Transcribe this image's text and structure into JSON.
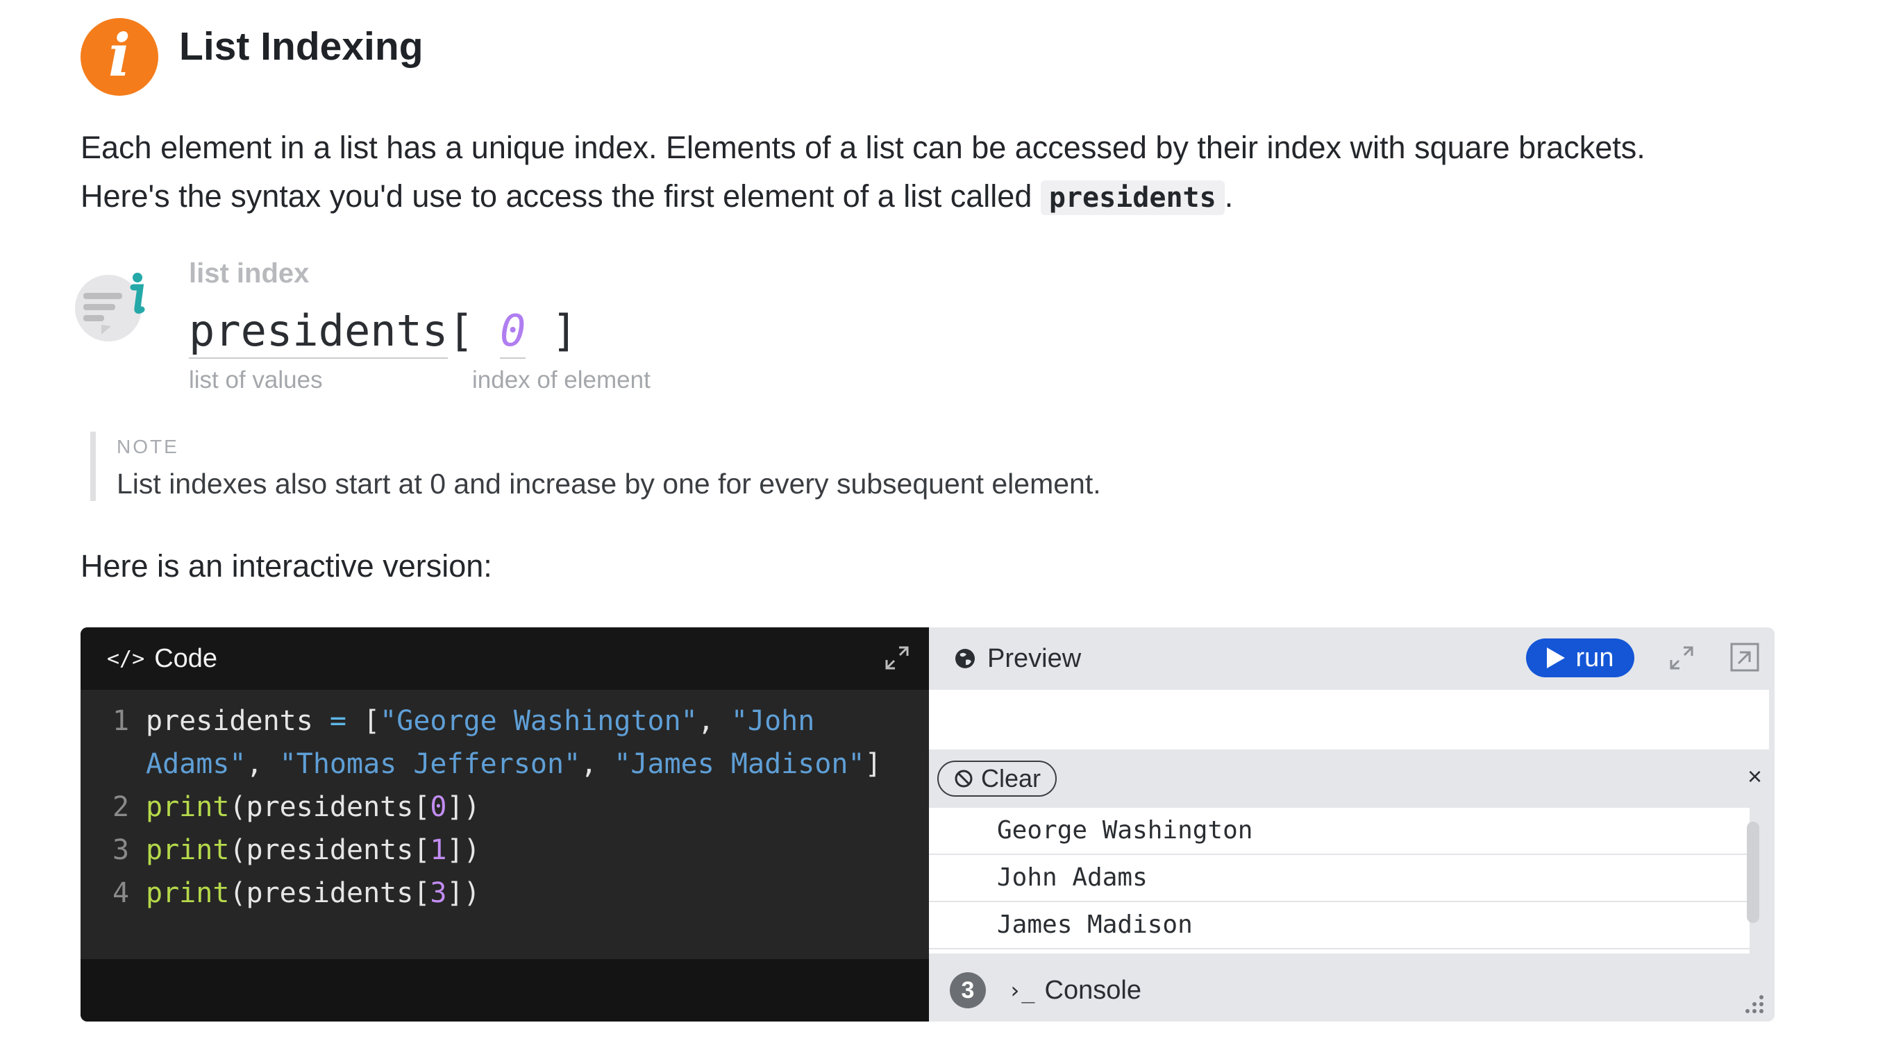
{
  "header": {
    "title": "List Indexing",
    "badge": "i"
  },
  "intro": {
    "line1": "Each element in a list has a unique index. Elements of a list can be accessed by their index with square brackets.",
    "line2_before": "Here's the syntax you'd use to access the first element of a list called",
    "code": "presidents",
    "line2_after": "."
  },
  "syntax": {
    "label": "list index",
    "part_list": "presidents",
    "bracket_open": "[ ",
    "index": "0",
    "bracket_close": " ]",
    "sub_list": "list of values",
    "sub_index": "index of element"
  },
  "note": {
    "label": "NOTE",
    "text": "List indexes also start at 0 and increase by one for every subsequent element."
  },
  "interactive_label": "Here is an interactive version:",
  "code_pane": {
    "title": "Code",
    "lines": [
      {
        "num": "1",
        "parts": [
          {
            "t": "presidents ",
            "c": "t-var"
          },
          {
            "t": "=",
            "c": "t-op"
          },
          {
            "t": " [",
            "c": "t-punc"
          },
          {
            "t": "\"George Washington\"",
            "c": "t-str"
          },
          {
            "t": ", ",
            "c": "t-punc"
          },
          {
            "t": "\"John",
            "c": "t-str"
          }
        ]
      },
      {
        "num": "",
        "parts": [
          {
            "t": "Adams\"",
            "c": "t-str"
          },
          {
            "t": ", ",
            "c": "t-punc"
          },
          {
            "t": "\"Thomas Jefferson\"",
            "c": "t-str"
          },
          {
            "t": ", ",
            "c": "t-punc"
          },
          {
            "t": "\"James Madison\"",
            "c": "t-str"
          },
          {
            "t": "]",
            "c": "t-punc"
          }
        ]
      },
      {
        "num": "2",
        "parts": [
          {
            "t": "print",
            "c": "t-fn"
          },
          {
            "t": "(presidents[",
            "c": "t-var"
          },
          {
            "t": "0",
            "c": "t-num"
          },
          {
            "t": "])",
            "c": "t-var"
          }
        ]
      },
      {
        "num": "3",
        "parts": [
          {
            "t": "print",
            "c": "t-fn"
          },
          {
            "t": "(presidents[",
            "c": "t-var"
          },
          {
            "t": "1",
            "c": "t-num"
          },
          {
            "t": "])",
            "c": "t-var"
          }
        ]
      },
      {
        "num": "4",
        "parts": [
          {
            "t": "print",
            "c": "t-fn"
          },
          {
            "t": "(presidents[",
            "c": "t-var"
          },
          {
            "t": "3",
            "c": "t-num"
          },
          {
            "t": "])",
            "c": "t-var"
          }
        ]
      }
    ]
  },
  "preview_pane": {
    "title": "Preview",
    "run_label": "run",
    "clear_label": "Clear",
    "close_symbol": "×",
    "console_output": [
      "George Washington",
      "John Adams",
      "James Madison"
    ],
    "console_count": "3",
    "console_label": "Console",
    "prompt_symbol": "›_"
  },
  "colors": {
    "accent_orange": "#f47c1a",
    "run_blue": "#1456d6",
    "code_bg": "#262626",
    "preview_bg": "#e4e6ea"
  },
  "icons": [
    "info-icon",
    "syntax-info-icon",
    "code-tag-icon",
    "expand-icon",
    "globe-icon",
    "play-icon",
    "popout-icon",
    "clear-icon",
    "close-icon",
    "console-prompt-icon",
    "resize-grip-icon"
  ]
}
